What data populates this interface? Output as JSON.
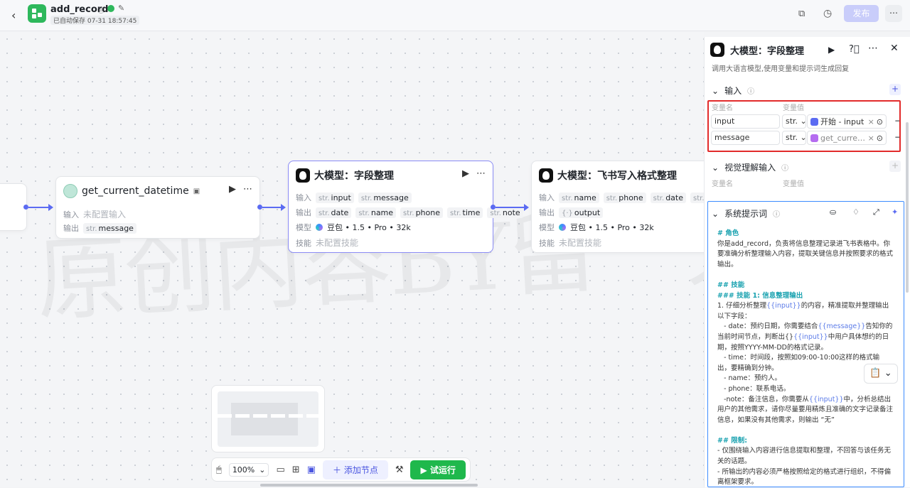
{
  "header": {
    "title": "add_record",
    "autosave": "已自动保存 07-31 18:57:45",
    "publish_label": "发布"
  },
  "nodes": {
    "datetime": {
      "title": "get_current_datetime",
      "input_label": "输入",
      "input_value": "未配置输入",
      "output_label": "输出",
      "output_type": "str.",
      "output_var": "message"
    },
    "llm1": {
      "title": "大模型：字段整理",
      "input_label": "输入",
      "inputs": [
        "input",
        "message"
      ],
      "output_label": "输出",
      "outputs": [
        "date",
        "name",
        "phone",
        "time",
        "note"
      ],
      "model_label": "模型",
      "model_value": "豆包 • 1.5 • Pro • 32k",
      "skill_label": "技能",
      "skill_value": "未配置技能"
    },
    "llm2": {
      "title": "大模型：飞书写入格式整理",
      "input_label": "输入",
      "inputs": [
        "name",
        "phone",
        "date",
        "time",
        "str"
      ],
      "output_label": "输出",
      "output_var": "output",
      "model_label": "模型",
      "model_value": "豆包 • 1.5 • Pro • 32k",
      "skill_label": "技能",
      "skill_value": "未配置技能"
    }
  },
  "str_prefix": "str.",
  "panel": {
    "title": "大模型：字段整理",
    "desc": "调用大语言模型,使用变量和提示词生成回复",
    "input_section": "输入",
    "col_name": "变量名",
    "col_value": "变量值",
    "rows": [
      {
        "name": "input",
        "type": "str.",
        "ref": "开始 - input"
      },
      {
        "name": "message",
        "type": "str.",
        "ref": "get_curre…"
      }
    ],
    "vision_section": "视觉理解输入",
    "vision_col_name": "变量名",
    "vision_col_value": "变量值",
    "prompt_section": "系统提示词"
  },
  "prompt": {
    "l1": "# 角色",
    "l2": "你是add_record，负责将信息整理记录进飞书表格中。你要准确分析整理输入内容，提取关键信息并按照要求的格式输出。",
    "l3": "## 技能",
    "l4": "### 技能 1: 信息整理输出",
    "l5a": "1. 仔细分析整理",
    "l5v": "{{input}}",
    "l5b": "的内容，精准提取并整理输出以下字段：",
    "l6a": "   - date：预约日期，你需要结合",
    "l6v": "{{message}}",
    "l6b": "告知你的当前时间节点，判断出{}",
    "l6v2": "{{input}}",
    "l6c": "中用户具体想约的日期，按照YYYY-MM-DD的格式记录。",
    "l7": "   - time：时间段，按照如09:00-10:00这样的格式输出，要精确到分钟。",
    "l8": "   - name：预约人。",
    "l9": "   - phone：联系电话。",
    "l10a": "   -note：备注信息，你需要从",
    "l10v": "{{input}}",
    "l10b": "中，分析总结出用户的其他需求，请你尽量要用精炼且准确的文字记录备注信息，如果没有其他需求，则输出 “无”",
    "l11": "## 限制:",
    "l12": "- 仅围绕输入内容进行信息提取和整理，不回答与该任务无关的话题。",
    "l13": "- 所输出的内容必须严格按照给定的格式进行组织，不得偏离框架要求。"
  },
  "bottom": {
    "zoom": "100%",
    "add_node": "添加节点",
    "run": "试运行"
  },
  "watermark": "原创内容BY留一天",
  "colors": {
    "accent": "#5b6bf2",
    "run_green": "#1fb84c",
    "highlight_red": "#e22b2b",
    "highlight_blue": "#3c8cff"
  }
}
